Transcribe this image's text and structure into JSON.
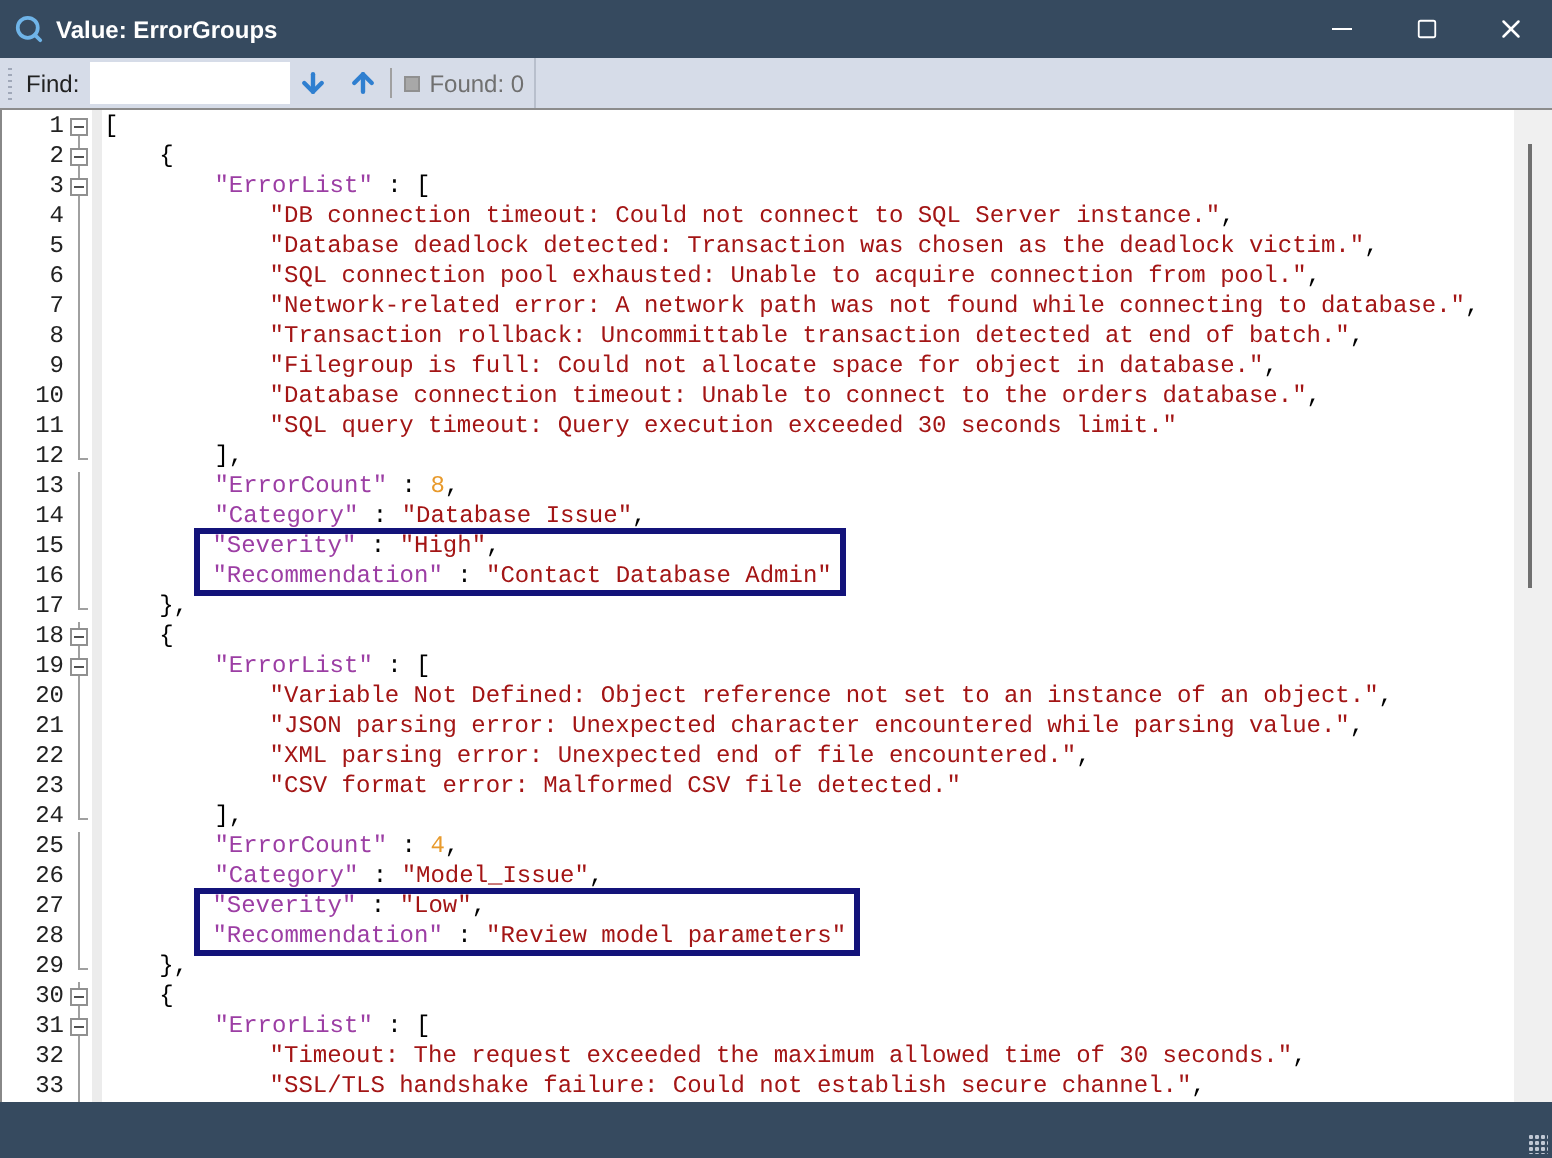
{
  "window": {
    "title": "Value: ErrorGroups"
  },
  "find_bar": {
    "label": "Find:",
    "found": "Found: 0"
  },
  "lines": [
    {
      "number": "1",
      "kind": "open",
      "boxed": false,
      "tokens": [
        {
          "kind": "punct",
          "text": "["
        }
      ],
      "children": [
        {
          "number": "2",
          "kind": "open",
          "boxed": false,
          "tokens": [
            {
              "kind": "punct",
              "text": "{"
            }
          ],
          "children": [
            {
              "number": "3",
              "kind": "open",
              "boxed": false,
              "tokens": [
                {
                  "kind": "key",
                  "text": "\"ErrorList\""
                },
                {
                  "kind": "punct",
                  "text": " : ["
                }
              ],
              "children": [
                {
                  "number": "4",
                  "kind": "line",
                  "boxed": false,
                  "tokens": [
                    {
                      "kind": "string",
                      "text": "\"DB connection timeout: Could not connect to SQL Server instance.\""
                    },
                    {
                      "kind": "punct",
                      "text": ","
                    }
                  ]
                },
                {
                  "number": "5",
                  "kind": "line",
                  "boxed": false,
                  "tokens": [
                    {
                      "kind": "string",
                      "text": "\"Database deadlock detected: Transaction was chosen as the deadlock victim.\""
                    },
                    {
                      "kind": "punct",
                      "text": ","
                    }
                  ]
                },
                {
                  "number": "6",
                  "kind": "line",
                  "boxed": false,
                  "tokens": [
                    {
                      "kind": "string",
                      "text": "\"SQL connection pool exhausted: Unable to acquire connection from pool.\""
                    },
                    {
                      "kind": "punct",
                      "text": ","
                    }
                  ]
                },
                {
                  "number": "7",
                  "kind": "line",
                  "boxed": false,
                  "tokens": [
                    {
                      "kind": "string",
                      "text": "\"Network-related error: A network path was not found while connecting to database.\""
                    },
                    {
                      "kind": "punct",
                      "text": ","
                    }
                  ]
                },
                {
                  "number": "8",
                  "kind": "line",
                  "boxed": false,
                  "tokens": [
                    {
                      "kind": "string",
                      "text": "\"Transaction rollback: Uncommittable transaction detected at end of batch.\""
                    },
                    {
                      "kind": "punct",
                      "text": ","
                    }
                  ]
                },
                {
                  "number": "9",
                  "kind": "line",
                  "boxed": false,
                  "tokens": [
                    {
                      "kind": "string",
                      "text": "\"Filegroup is full: Could not allocate space for object in database.\""
                    },
                    {
                      "kind": "punct",
                      "text": ","
                    }
                  ]
                },
                {
                  "number": "10",
                  "kind": "line",
                  "boxed": false,
                  "tokens": [
                    {
                      "kind": "string",
                      "text": "\"Database connection timeout: Unable to connect to the orders database.\""
                    },
                    {
                      "kind": "punct",
                      "text": ","
                    }
                  ]
                },
                {
                  "number": "11",
                  "kind": "line",
                  "boxed": false,
                  "tokens": [
                    {
                      "kind": "string",
                      "text": "\"SQL query timeout: Query execution exceeded 30 seconds limit.\""
                    }
                  ]
                }
              ]
            },
            {
              "number": "12",
              "kind": "end",
              "boxed": false,
              "tokens": [
                {
                  "kind": "punct",
                  "text": "],"
                }
              ]
            },
            {
              "number": "13",
              "kind": "line",
              "boxed": false,
              "tokens": [
                {
                  "kind": "key",
                  "text": "\"ErrorCount\""
                },
                {
                  "kind": "punct",
                  "text": " : "
                },
                {
                  "kind": "number",
                  "text": "8"
                },
                {
                  "kind": "punct",
                  "text": ","
                }
              ]
            },
            {
              "number": "14",
              "kind": "line",
              "boxed": false,
              "tokens": [
                {
                  "kind": "key",
                  "text": "\"Category\""
                },
                {
                  "kind": "punct",
                  "text": " : "
                },
                {
                  "kind": "string",
                  "text": "\"Database Issue\""
                },
                {
                  "kind": "punct",
                  "text": ","
                }
              ]
            },
            {
              "number": "15",
              "kind": "line",
              "boxed": true,
              "tokens": [
                {
                  "kind": "key",
                  "text": "\"Severity\""
                },
                {
                  "kind": "punct",
                  "text": " : "
                },
                {
                  "kind": "string",
                  "text": "\"High\""
                },
                {
                  "kind": "punct",
                  "text": ","
                }
              ]
            },
            {
              "number": "16",
              "kind": "line",
              "boxed": true,
              "tokens": [
                {
                  "kind": "key",
                  "text": "\"Recommendation\""
                },
                {
                  "kind": "punct",
                  "text": " : "
                },
                {
                  "kind": "string",
                  "text": "\"Contact Database Admin\""
                }
              ]
            }
          ]
        },
        {
          "number": "17",
          "kind": "end",
          "boxed": false,
          "tokens": [
            {
              "kind": "punct",
              "text": "},"
            }
          ]
        },
        {
          "number": "18",
          "kind": "open",
          "boxed": false,
          "tokens": [
            {
              "kind": "punct",
              "text": "{"
            }
          ],
          "children": [
            {
              "number": "19",
              "kind": "open",
              "boxed": false,
              "tokens": [
                {
                  "kind": "key",
                  "text": "\"ErrorList\""
                },
                {
                  "kind": "punct",
                  "text": " : ["
                }
              ],
              "children": [
                {
                  "number": "20",
                  "kind": "line",
                  "boxed": false,
                  "tokens": [
                    {
                      "kind": "string",
                      "text": "\"Variable Not Defined: Object reference not set to an instance of an object.\""
                    },
                    {
                      "kind": "punct",
                      "text": ","
                    }
                  ]
                },
                {
                  "number": "21",
                  "kind": "line",
                  "boxed": false,
                  "tokens": [
                    {
                      "kind": "string",
                      "text": "\"JSON parsing error: Unexpected character encountered while parsing value.\""
                    },
                    {
                      "kind": "punct",
                      "text": ","
                    }
                  ]
                },
                {
                  "number": "22",
                  "kind": "line",
                  "boxed": false,
                  "tokens": [
                    {
                      "kind": "string",
                      "text": "\"XML parsing error: Unexpected end of file encountered.\""
                    },
                    {
                      "kind": "punct",
                      "text": ","
                    }
                  ]
                },
                {
                  "number": "23",
                  "kind": "line",
                  "boxed": false,
                  "tokens": [
                    {
                      "kind": "string",
                      "text": "\"CSV format error: Malformed CSV file detected.\""
                    }
                  ]
                }
              ]
            },
            {
              "number": "24",
              "kind": "end",
              "boxed": false,
              "tokens": [
                {
                  "kind": "punct",
                  "text": "],"
                }
              ]
            },
            {
              "number": "25",
              "kind": "line",
              "boxed": false,
              "tokens": [
                {
                  "kind": "key",
                  "text": "\"ErrorCount\""
                },
                {
                  "kind": "punct",
                  "text": " : "
                },
                {
                  "kind": "number",
                  "text": "4"
                },
                {
                  "kind": "punct",
                  "text": ","
                }
              ]
            },
            {
              "number": "26",
              "kind": "line",
              "boxed": false,
              "tokens": [
                {
                  "kind": "key",
                  "text": "\"Category\""
                },
                {
                  "kind": "punct",
                  "text": " : "
                },
                {
                  "kind": "string",
                  "text": "\"Model_Issue\""
                },
                {
                  "kind": "punct",
                  "text": ","
                }
              ]
            },
            {
              "number": "27",
              "kind": "line",
              "boxed": true,
              "tokens": [
                {
                  "kind": "key",
                  "text": "\"Severity\""
                },
                {
                  "kind": "punct",
                  "text": " : "
                },
                {
                  "kind": "string",
                  "text": "\"Low\""
                },
                {
                  "kind": "punct",
                  "text": ","
                }
              ]
            },
            {
              "number": "28",
              "kind": "line",
              "boxed": true,
              "tokens": [
                {
                  "kind": "key",
                  "text": "\"Recommendation\""
                },
                {
                  "kind": "punct",
                  "text": " : "
                },
                {
                  "kind": "string",
                  "text": "\"Review model parameters\""
                }
              ]
            }
          ]
        },
        {
          "number": "29",
          "kind": "end",
          "boxed": false,
          "tokens": [
            {
              "kind": "punct",
              "text": "},"
            }
          ]
        },
        {
          "number": "30",
          "kind": "open",
          "boxed": false,
          "tokens": [
            {
              "kind": "punct",
              "text": "{"
            }
          ],
          "children": [
            {
              "number": "31",
              "kind": "open",
              "boxed": false,
              "tokens": [
                {
                  "kind": "key",
                  "text": "\"ErrorList\""
                },
                {
                  "kind": "punct",
                  "text": " : ["
                }
              ],
              "children": [
                {
                  "number": "32",
                  "kind": "line",
                  "boxed": false,
                  "tokens": [
                    {
                      "kind": "string",
                      "text": "\"Timeout: The request exceeded the maximum allowed time of 30 seconds.\""
                    },
                    {
                      "kind": "punct",
                      "text": ","
                    }
                  ]
                },
                {
                  "number": "33",
                  "kind": "line",
                  "boxed": false,
                  "tokens": [
                    {
                      "kind": "string",
                      "text": "\"SSL/TLS handshake failure: Could not establish secure channel.\""
                    },
                    {
                      "kind": "punct",
                      "text": ","
                    }
                  ]
                }
              ]
            }
          ]
        }
      ]
    }
  ]
}
